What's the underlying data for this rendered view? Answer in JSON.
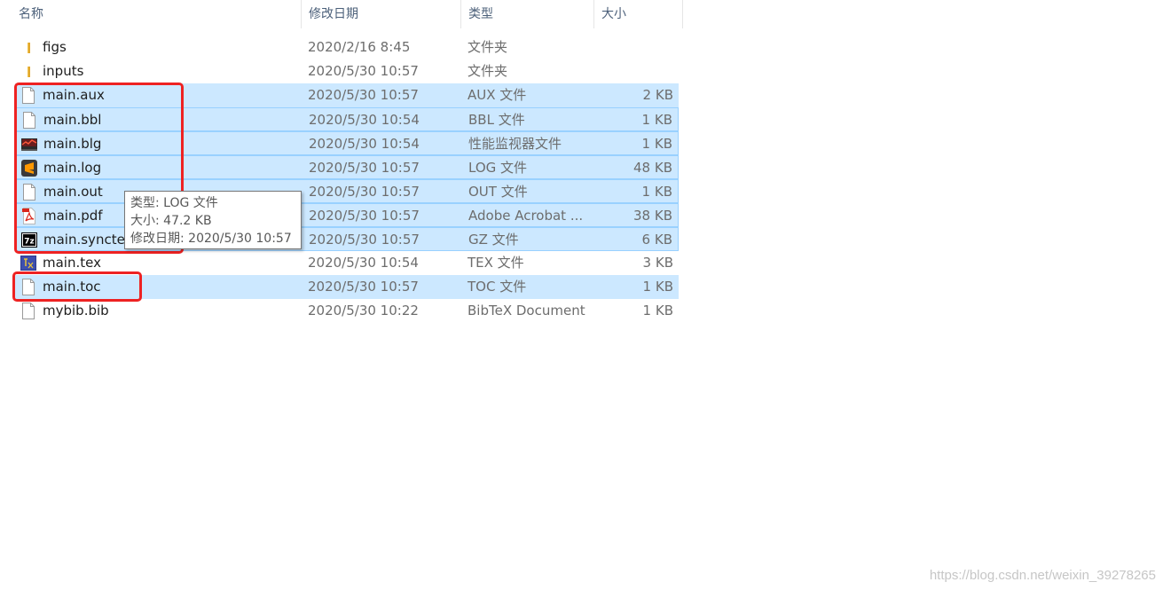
{
  "header": {
    "name": "名称",
    "date": "修改日期",
    "type": "类型",
    "size": "大小",
    "sort_arrow": "^"
  },
  "files": [
    {
      "name": "figs",
      "date": "2020/2/16 8:45",
      "type": "文件夹",
      "size": "",
      "icon": "folder-icon",
      "selected": false
    },
    {
      "name": "inputs",
      "date": "2020/5/30 10:57",
      "type": "文件夹",
      "size": "",
      "icon": "folder-icon",
      "selected": false
    },
    {
      "name": "main.aux",
      "date": "2020/5/30 10:57",
      "type": "AUX 文件",
      "size": "2 KB",
      "icon": "blank-file-icon",
      "selected": true
    },
    {
      "name": "main.bbl",
      "date": "2020/5/30 10:54",
      "type": "BBL 文件",
      "size": "1 KB",
      "icon": "blank-file-icon",
      "selected": true
    },
    {
      "name": "main.blg",
      "date": "2020/5/30 10:54",
      "type": "性能监视器文件",
      "size": "1 KB",
      "icon": "perfmon-file-icon",
      "selected": true
    },
    {
      "name": "main.log",
      "date": "2020/5/30 10:57",
      "type": "LOG 文件",
      "size": "48 KB",
      "icon": "sublime-file-icon",
      "selected": true
    },
    {
      "name": "main.out",
      "date": "2020/5/30 10:57",
      "type": "OUT 文件",
      "size": "1 KB",
      "icon": "blank-file-icon",
      "selected": true
    },
    {
      "name": "main.pdf",
      "date": "2020/5/30 10:57",
      "type": "Adobe Acrobat ...",
      "size": "38 KB",
      "icon": "pdf-file-icon",
      "selected": true
    },
    {
      "name": "main.synctex",
      "date": "2020/5/30 10:57",
      "type": "GZ 文件",
      "size": "6 KB",
      "icon": "7zip-file-icon",
      "selected": true
    },
    {
      "name": "main.tex",
      "date": "2020/5/30 10:54",
      "type": "TEX 文件",
      "size": "3 KB",
      "icon": "tex-file-icon",
      "selected": false
    },
    {
      "name": "main.toc",
      "date": "2020/5/30 10:57",
      "type": "TOC 文件",
      "size": "1 KB",
      "icon": "blank-file-icon",
      "selected": true
    },
    {
      "name": "mybib.bib",
      "date": "2020/5/30 10:22",
      "type": "BibTeX Document",
      "size": "1 KB",
      "icon": "blank-file-icon",
      "selected": false
    }
  ],
  "tooltip": {
    "line1": "类型: LOG 文件",
    "line2": "大小: 47.2 KB",
    "line3": "修改日期: 2020/5/30 10:57"
  },
  "watermark": "https://blog.csdn.net/weixin_39278265",
  "colors": {
    "selection": "#cce8ff",
    "selection_border": "#99d1ff",
    "highlight": "#ee2222",
    "folder": "#f3c24b"
  }
}
